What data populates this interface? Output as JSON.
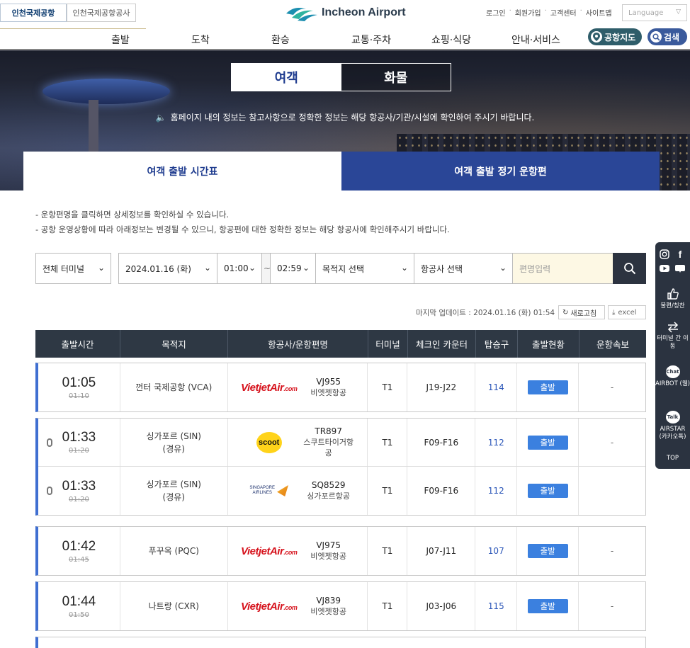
{
  "topbar": {
    "site_tabs": [
      "인천국제공항",
      "인천국제공항공사"
    ],
    "logo_text": "Incheon Airport",
    "util_links": [
      "로그인",
      "회원가입",
      "고객센터",
      "사이트맵"
    ],
    "language_placeholder": "Language"
  },
  "nav": {
    "items": [
      "출발",
      "도착",
      "환승",
      "교통·주차",
      "쇼핑·식당",
      "안내·서비스"
    ],
    "map_button": "공항지도",
    "search_button": "검색"
  },
  "hero": {
    "toggle": [
      "여객",
      "화물"
    ],
    "notice": "홈페이지 내의 정보는 참고사항으로 정확한 정보는 해당 항공사/기관/시설에 확인하여 주시기 바랍니다.",
    "subtabs": [
      "여객 출발 시간표",
      "여객 출발 정기 운항편"
    ]
  },
  "info_lines": [
    "- 운항편명을 클릭하면 상세정보를 확인하실 수 있습니다.",
    "- 공항 운영상황에 따라 아래정보는 변경될 수 있으니, 항공편에 대한 정확한 정보는 해당 항공사에 확인해주시기 바랍니다."
  ],
  "filters": {
    "terminal": "전체 터미널",
    "date": "2024.01.16 (화)",
    "time_from": "01:00",
    "tilde": "~",
    "time_to": "02:59",
    "destination": "목적지 선택",
    "airline": "항공사 선택",
    "flight_placeholder": "편명입력"
  },
  "update": {
    "text": "마지막 업데이트 : 2024.01.16 (화) 01:54",
    "refresh": "새로고침",
    "excel": "excel"
  },
  "table": {
    "headers": [
      "출발시간",
      "목적지",
      "항공사/운항편명",
      "터미널",
      "체크인 카운터",
      "탑승구",
      "출발현황",
      "운항속보"
    ],
    "groups": [
      {
        "rows": [
          {
            "time": "01:05",
            "scheduled": "01:10",
            "dest1": "껀터 국제공항 (VCA)",
            "dest2": "",
            "logo": "vietjet",
            "flight": "VJ955",
            "airline": "비엣젯항공",
            "terminal": "T1",
            "counter": "J19-J22",
            "gate": "114",
            "status": "출발",
            "news": "-"
          }
        ]
      },
      {
        "rows": [
          {
            "time": "01:33",
            "scheduled": "01:20",
            "dest1": "싱가포르 (SIN)",
            "dest2": "(경유)",
            "logo": "scoot",
            "flight": "TR897",
            "airline": "스쿠트타이거항공",
            "terminal": "T1",
            "counter": "F09-F16",
            "gate": "112",
            "status": "출발",
            "news": "-",
            "codeshare": true
          },
          {
            "time": "01:33",
            "scheduled": "01:20",
            "dest1": "싱가포르 (SIN)",
            "dest2": "(경유)",
            "logo": "sia",
            "flight": "SQ8529",
            "airline": "싱가포르항공",
            "terminal": "T1",
            "counter": "F09-F16",
            "gate": "112",
            "status": "출발",
            "news": "",
            "codeshare": true
          }
        ]
      },
      {
        "rows": [
          {
            "time": "01:42",
            "scheduled": "01:45",
            "dest1": "푸꾸옥 (PQC)",
            "dest2": "",
            "logo": "vietjet",
            "flight": "VJ975",
            "airline": "비엣젯항공",
            "terminal": "T1",
            "counter": "J07-J11",
            "gate": "107",
            "status": "출발",
            "news": "-"
          }
        ]
      },
      {
        "rows": [
          {
            "time": "01:44",
            "scheduled": "01:50",
            "dest1": "나트랑 (CXR)",
            "dest2": "",
            "logo": "vietjet",
            "flight": "VJ839",
            "airline": "비엣젯항공",
            "terminal": "T1",
            "counter": "J03-J06",
            "gate": "115",
            "status": "출발",
            "news": "-"
          }
        ]
      }
    ]
  },
  "logos": {
    "vietjet_main": "VietjetAir",
    "vietjet_suffix": ".com",
    "scoot": "scoot",
    "sia_line1": "SINGAPORE",
    "sia_line2": "AIRLINES"
  },
  "quick_menu": {
    "sns": [
      "instagram-icon",
      "facebook-icon",
      "youtube-icon",
      "blog-icon"
    ],
    "items": [
      "불편/칭찬",
      "터미널 간 이동",
      "AIRBOT (웹)",
      "AIRSTAR (카카오톡)",
      "TOP"
    ],
    "chat_badges": [
      "Chat",
      "Talk"
    ]
  },
  "colors": {
    "primary": "#1f3c8f",
    "accent_blue": "#3b80df",
    "header_dark": "#2e3844",
    "vietjet_red": "#d6121c"
  }
}
